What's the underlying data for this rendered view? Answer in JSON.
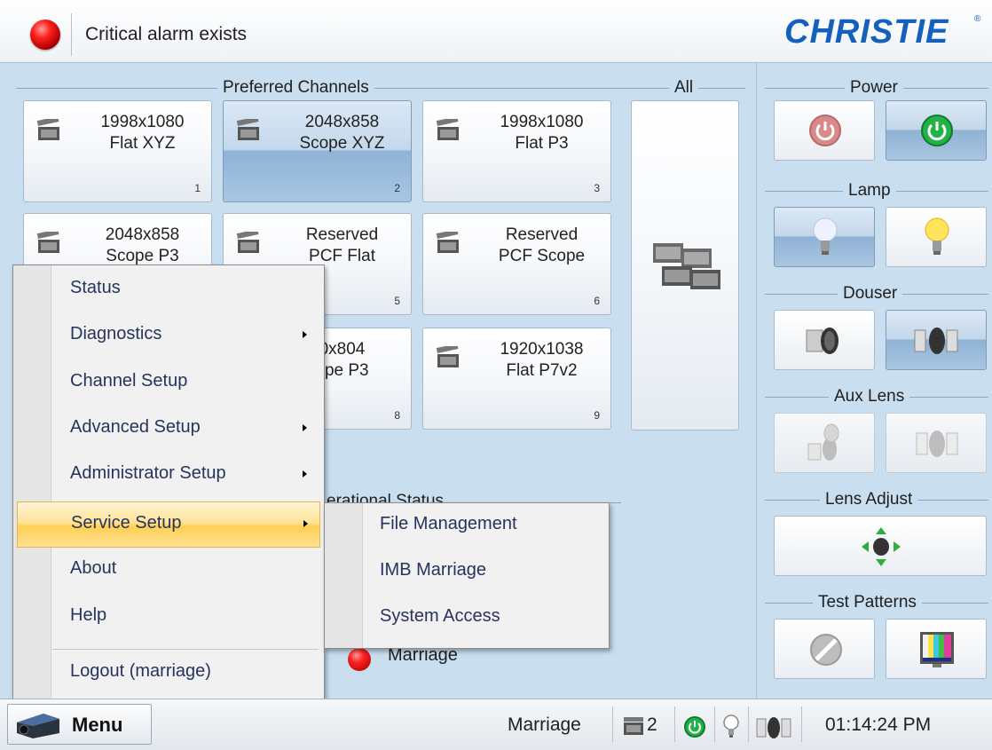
{
  "header": {
    "alarm_text": "Critical alarm exists",
    "logo": "CHRISTIE",
    "alarm_led": "red-led-icon"
  },
  "sections": {
    "preferred_channels": "Preferred Channels",
    "all": "All",
    "power": "Power",
    "lamp": "Lamp",
    "douser": "Douser",
    "aux_lens": "Aux Lens",
    "lens_adjust": "Lens Adjust",
    "test_patterns": "Test Patterns",
    "operational_status_partial": "erational Status"
  },
  "channels": [
    {
      "label": "1998x1080\nFlat XYZ",
      "num": "1",
      "active": false
    },
    {
      "label": "2048x858\nScope XYZ",
      "num": "2",
      "active": true
    },
    {
      "label": "1998x1080\nFlat P3",
      "num": "3",
      "active": false
    },
    {
      "label": "2048x858\nScope P3",
      "num": "",
      "active": false
    },
    {
      "label": "Reserved\nPCF Flat",
      "num": "5",
      "active": false
    },
    {
      "label": "Reserved\nPCF Scope",
      "num": "6",
      "active": false
    },
    {
      "label": "0x804\nope P3",
      "num": "8",
      "active": false
    },
    {
      "label": "1920x1038\nFlat P7v2",
      "num": "9",
      "active": false
    }
  ],
  "menu": {
    "items": [
      {
        "label": "Status",
        "submenu": false
      },
      {
        "label": "Diagnostics",
        "submenu": true
      },
      {
        "label": "Channel Setup",
        "submenu": false
      },
      {
        "label": "Advanced Setup",
        "submenu": true
      },
      {
        "label": "Administrator Setup",
        "submenu": true
      },
      {
        "label": "Service Setup",
        "submenu": true,
        "highlighted": true
      },
      {
        "label": "About",
        "submenu": false
      },
      {
        "label": "Help",
        "submenu": false
      },
      {
        "label": "Logout (marriage)",
        "submenu": false
      }
    ],
    "submenu_items": [
      "File Management",
      "IMB Marriage",
      "System Access"
    ]
  },
  "operational": {
    "marriage_label": "Marriage"
  },
  "statusbar": {
    "menu_label": "Menu",
    "marriage": "Marriage",
    "channel_count": "2",
    "time": "01:14:24 PM"
  },
  "colors": {
    "background": "#c9dff0",
    "logo_blue": "#1560bd",
    "alarm_red": "#e00000",
    "menu_highlight": "#ffcf52"
  }
}
